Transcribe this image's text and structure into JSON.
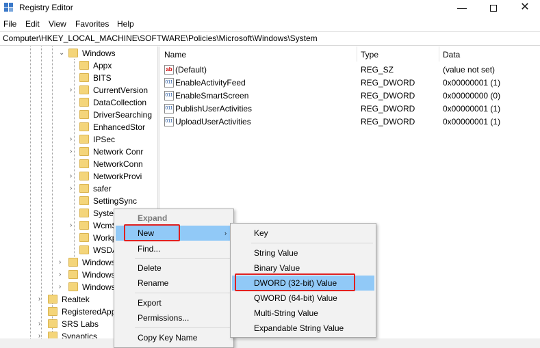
{
  "window": {
    "title": "Registry Editor",
    "min": "—",
    "close": "✕"
  },
  "menu": [
    "File",
    "Edit",
    "View",
    "Favorites",
    "Help"
  ],
  "address": "Computer\\HKEY_LOCAL_MACHINE\\SOFTWARE\\Policies\\Microsoft\\Windows\\System",
  "tree": [
    {
      "label": "Windows",
      "level": 0,
      "expander": "⌄"
    },
    {
      "label": "Appx",
      "level": 1,
      "expander": ""
    },
    {
      "label": "BITS",
      "level": 1,
      "expander": ""
    },
    {
      "label": "CurrentVersion",
      "level": 1,
      "expander": "›"
    },
    {
      "label": "DataCollection",
      "level": 1,
      "expander": ""
    },
    {
      "label": "DriverSearching",
      "level": 1,
      "expander": ""
    },
    {
      "label": "EnhancedStor",
      "level": 1,
      "expander": ""
    },
    {
      "label": "IPSec",
      "level": 1,
      "expander": "›"
    },
    {
      "label": "Network Conr",
      "level": 1,
      "expander": "›"
    },
    {
      "label": "NetworkConn",
      "level": 1,
      "expander": ""
    },
    {
      "label": "NetworkProvi",
      "level": 1,
      "expander": "›"
    },
    {
      "label": "safer",
      "level": 1,
      "expander": "›"
    },
    {
      "label": "SettingSync",
      "level": 1,
      "expander": ""
    },
    {
      "label": "System",
      "level": 1,
      "expander": ""
    },
    {
      "label": "WcmS",
      "level": 1,
      "expander": "›"
    },
    {
      "label": "Workp",
      "level": 1,
      "expander": ""
    },
    {
      "label": "WSDA",
      "level": 1,
      "expander": ""
    },
    {
      "label": "Windows",
      "level": 0,
      "expander": "›"
    },
    {
      "label": "Windows",
      "level": 0,
      "expander": "›"
    },
    {
      "label": "Windows",
      "level": 0,
      "expander": "›"
    },
    {
      "label": "Realtek",
      "level": -1,
      "expander": "›"
    },
    {
      "label": "RegisteredApp",
      "level": -1,
      "expander": ""
    },
    {
      "label": "SRS Labs",
      "level": -1,
      "expander": "›"
    },
    {
      "label": "Synaptics",
      "level": -1,
      "expander": "›"
    }
  ],
  "columns": {
    "name": "Name",
    "type": "Type",
    "data": "Data"
  },
  "values": [
    {
      "icon": "ab",
      "name": "(Default)",
      "type": "REG_SZ",
      "data": "(value not set)"
    },
    {
      "icon": "011",
      "name": "EnableActivityFeed",
      "type": "REG_DWORD",
      "data": "0x00000001 (1)"
    },
    {
      "icon": "011",
      "name": "EnableSmartScreen",
      "type": "REG_DWORD",
      "data": "0x00000000 (0)"
    },
    {
      "icon": "011",
      "name": "PublishUserActivities",
      "type": "REG_DWORD",
      "data": "0x00000001 (1)"
    },
    {
      "icon": "011",
      "name": "UploadUserActivities",
      "type": "REG_DWORD",
      "data": "0x00000001 (1)"
    }
  ],
  "context_menu": {
    "expand": "Expand",
    "new": "New",
    "find": "Find...",
    "delete": "Delete",
    "rename": "Rename",
    "export": "Export",
    "permissions": "Permissions...",
    "copy_key_name": "Copy Key Name",
    "submenu_arrow": "›"
  },
  "submenu": {
    "key": "Key",
    "string": "String Value",
    "binary": "Binary Value",
    "dword": "DWORD (32-bit) Value",
    "qword": "QWORD (64-bit) Value",
    "multi": "Multi-String Value",
    "expandable": "Expandable String Value"
  },
  "highlight_color": "#91c9f7",
  "annotation_color": "#e02020"
}
